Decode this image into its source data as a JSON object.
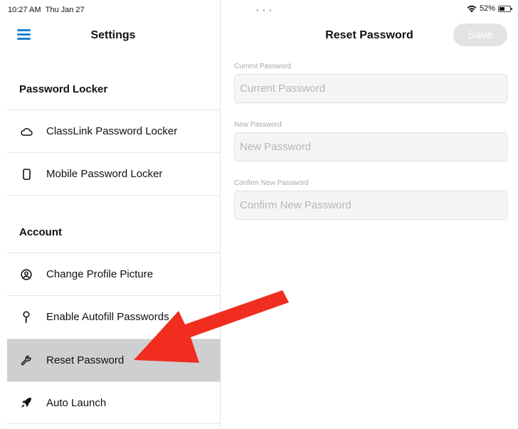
{
  "status_bar": {
    "time": "10:27 AM",
    "date": "Thu Jan 27",
    "dots": "• • •",
    "battery_percent": "52%",
    "battery_level": 0.52,
    "wifi_icon": "wifi-icon",
    "battery_icon": "battery-icon"
  },
  "sidebar": {
    "title": "Settings",
    "menu_icon": "hamburger-menu-icon",
    "sections": [
      {
        "header": "Password Locker",
        "items": [
          {
            "label": "ClassLink Password Locker",
            "icon": "cloud-icon"
          },
          {
            "label": "Mobile Password Locker",
            "icon": "phone-icon"
          }
        ]
      },
      {
        "header": "Account",
        "items": [
          {
            "label": "Change Profile Picture",
            "icon": "user-circle-icon"
          },
          {
            "label": "Enable Autofill Passwords",
            "icon": "key-icon"
          },
          {
            "label": "Reset Password",
            "icon": "wrench-icon",
            "selected": true
          },
          {
            "label": "Auto Launch",
            "icon": "rocket-icon"
          }
        ]
      }
    ]
  },
  "detail": {
    "title": "Reset Password",
    "save_label": "Save",
    "fields": [
      {
        "label": "Current Password",
        "placeholder": "Current Password",
        "value": ""
      },
      {
        "label": "New Password",
        "placeholder": "New Password",
        "value": ""
      },
      {
        "label": "Confirm New Password",
        "placeholder": "Confirm New Password",
        "value": ""
      }
    ]
  },
  "annotation": {
    "color": "#f02d1e",
    "icon": "red-arrow-icon"
  }
}
